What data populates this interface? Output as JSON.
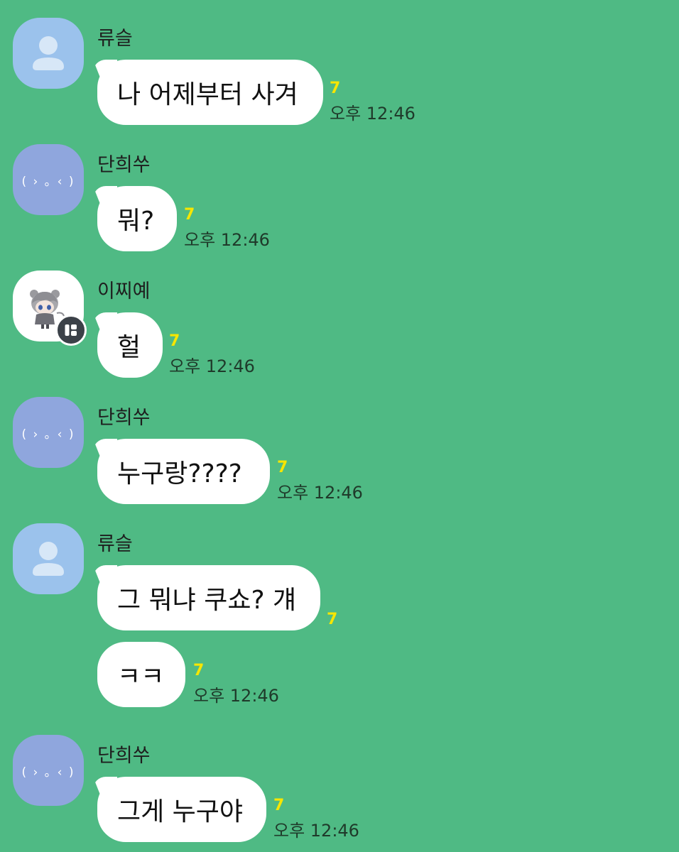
{
  "chat": {
    "messages": [
      {
        "sender": "류슬",
        "avatar": "default-person-icon",
        "avatar_color": "#9BC2EC",
        "bubbles": [
          {
            "text": "나 어제부터 사겨",
            "unread": "7",
            "time": "오후 12:46"
          }
        ]
      },
      {
        "sender": "단희쑤",
        "avatar": "emoticon-face",
        "avatar_color": "#8FA6DD",
        "avatar_emoticon": "( › ｡ ‹ )",
        "bubbles": [
          {
            "text": "뭐?",
            "unread": "7",
            "time": "오후 12:46"
          }
        ]
      },
      {
        "sender": "이찌예",
        "avatar": "anime-character-image",
        "avatar_color": "#FFFFFF",
        "avatar_badge": "kakao-profile-badge-icon",
        "bubbles": [
          {
            "text": "헐",
            "unread": "7",
            "time": "오후 12:46"
          }
        ]
      },
      {
        "sender": "단희쑤",
        "avatar": "emoticon-face",
        "avatar_color": "#8FA6DD",
        "avatar_emoticon": "( › ｡ ‹ )",
        "bubbles": [
          {
            "text": "누구랑????",
            "unread": "7",
            "time": "오후 12:46"
          }
        ]
      },
      {
        "sender": "류슬",
        "avatar": "default-person-icon",
        "avatar_color": "#9BC2EC",
        "bubbles": [
          {
            "text": "그 뭐냐 쿠쇼? 걔",
            "unread": "7",
            "time": ""
          },
          {
            "text": "ㅋㅋ",
            "unread": "7",
            "time": "오후 12:46"
          }
        ]
      },
      {
        "sender": "단희쑤",
        "avatar": "emoticon-face",
        "avatar_color": "#8FA6DD",
        "avatar_emoticon": "( › ｡ ‹ )",
        "bubbles": [
          {
            "text": "그게 누구야",
            "unread": "7",
            "time": "오후 12:46"
          }
        ]
      }
    ]
  },
  "colors": {
    "background": "#4FBA84",
    "bubble": "#FFFFFF",
    "unread_count": "#F7E600"
  }
}
